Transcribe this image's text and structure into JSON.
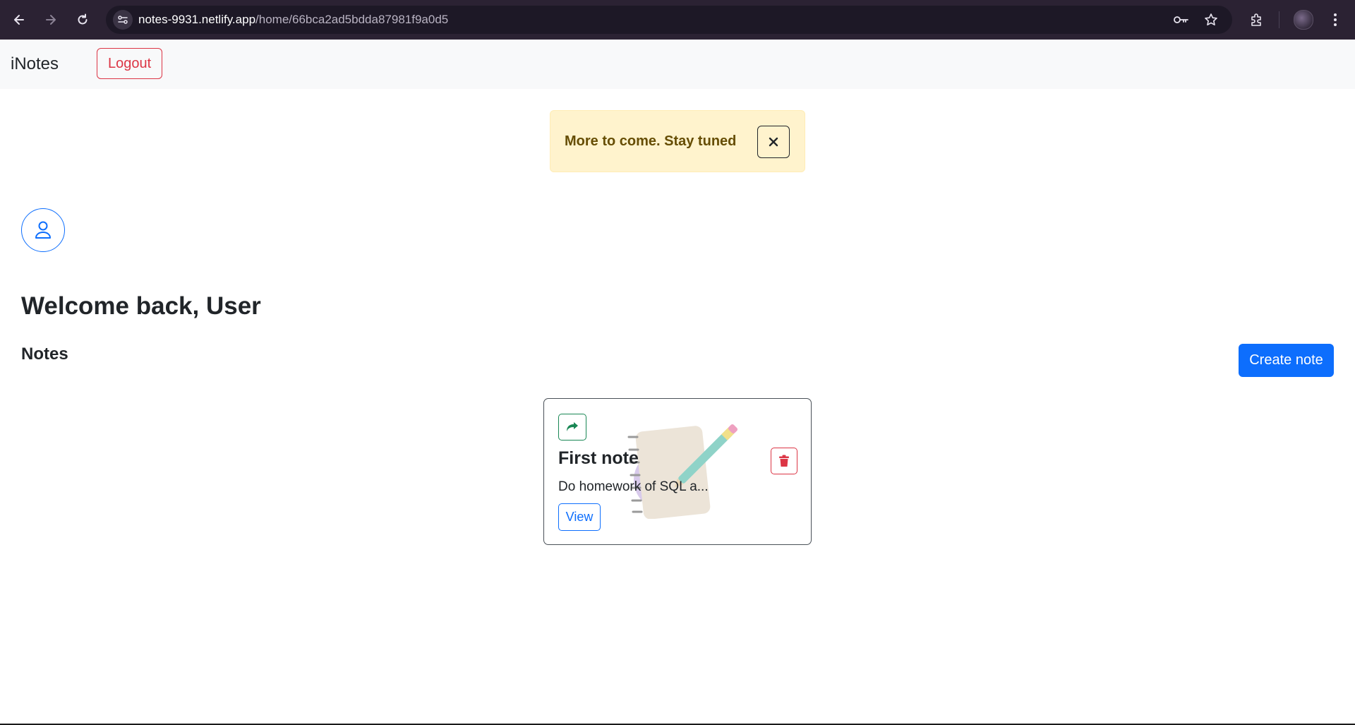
{
  "browser": {
    "url_host": "notes-9931.netlify.app",
    "url_path": "/home/66bca2ad5bdda87981f9a0d5",
    "icons": [
      "back-icon",
      "forward-icon",
      "reload-icon",
      "site-info-icon",
      "key-icon",
      "star-icon",
      "extensions-icon",
      "profile-icon",
      "menu-icon"
    ]
  },
  "navbar": {
    "brand": "iNotes",
    "logout_label": "Logout"
  },
  "alert": {
    "message": "More to come. Stay tuned",
    "close_glyph": "✕"
  },
  "main": {
    "welcome": "Welcome back, User",
    "notes_heading": "Notes",
    "create_label": "Create note"
  },
  "notes": [
    {
      "title": "First note",
      "preview": "Do homework of SQL a...",
      "view_label": "View"
    }
  ],
  "colors": {
    "primary": "#0d6efd",
    "danger": "#dc3545",
    "success": "#198754",
    "warning_bg": "#fff3cd",
    "warning_text": "#664d03",
    "chrome_bg": "#2b2233"
  }
}
